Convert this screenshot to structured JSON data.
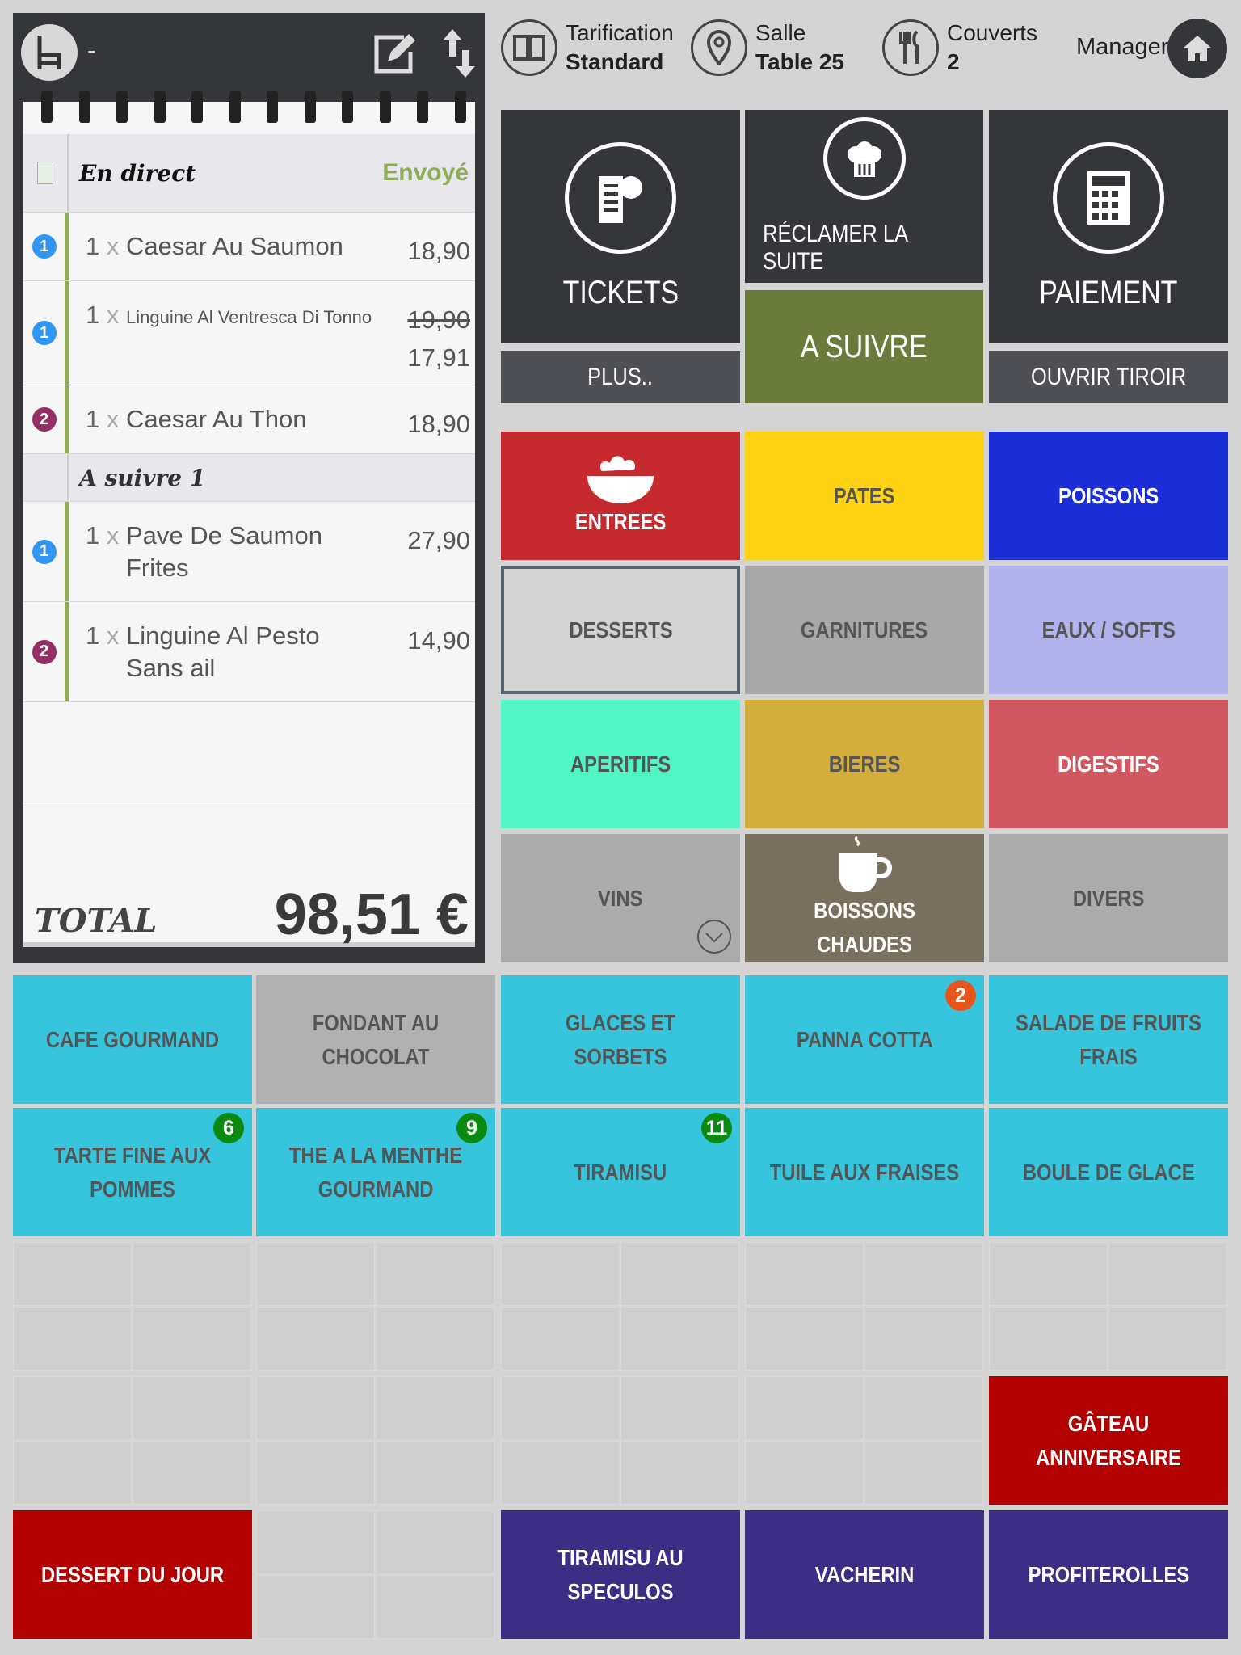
{
  "ticket": {
    "table_dash": "-",
    "header_label": "En direct",
    "header_status": "Envoyé",
    "lines": [
      {
        "seq": "1",
        "seq_color": "#2f96f3",
        "qty": "1",
        "x": "x",
        "name": "Caesar Au Saumon",
        "price": "18,90"
      },
      {
        "seq": "1",
        "seq_color": "#2f96f3",
        "qty": "1",
        "x": "x",
        "name": "Linguine Al Ventresca Di Tonno",
        "old_price": "19,90",
        "price": "17,91"
      },
      {
        "seq": "2",
        "seq_color": "#962e63",
        "qty": "1",
        "x": "x",
        "name": "Caesar Au Thon",
        "price": "18,90"
      }
    ],
    "next_label": "A suivre 1",
    "next_lines": [
      {
        "seq": "1",
        "seq_color": "#2f96f3",
        "qty": "1",
        "x": "x",
        "name": "Pave De Saumon",
        "note": "Frites",
        "price": "27,90"
      },
      {
        "seq": "2",
        "seq_color": "#962e63",
        "qty": "1",
        "x": "x",
        "name": "Linguine Al Pesto",
        "note": "Sans ail",
        "price": "14,90"
      }
    ],
    "total_label": "TOTAL",
    "total_value": "98,51 €"
  },
  "header": {
    "pricing_label": "Tarification",
    "pricing_value": "Standard",
    "room_label": "Salle",
    "room_value": "Table 25",
    "covers_label": "Couverts",
    "covers_value": "2",
    "user": "Manager"
  },
  "controls": {
    "tickets": "TICKETS",
    "more": "PLUS..",
    "claim": "RÉCLAMER LA SUITE",
    "next": "A SUIVRE",
    "payment": "PAIEMENT",
    "drawer": "OUVRIR TIROIR",
    "next_color": "#6a7b3b"
  },
  "categories": [
    {
      "label": "ENTREES",
      "bg": "#c62a2f",
      "fg": "#ffffff",
      "icon": "salad-bowl-icon"
    },
    {
      "label": "PATES",
      "bg": "#ffd314",
      "fg": "#555555"
    },
    {
      "label": "POISSONS",
      "bg": "#1a2dd6",
      "fg": "#ffffff"
    },
    {
      "label": "DESSERTS",
      "bg": "#d3d3d3",
      "fg": "#555555",
      "selected": true
    },
    {
      "label": "GARNITURES",
      "bg": "#a8a8a8",
      "fg": "#555555"
    },
    {
      "label": "EAUX / SOFTS",
      "bg": "#b2b2ec",
      "fg": "#555555"
    },
    {
      "label": "APERITIFS",
      "bg": "#52f5c6",
      "fg": "#555555"
    },
    {
      "label": "BIERES",
      "bg": "#d4ae3c",
      "fg": "#555555"
    },
    {
      "label": "DIGESTIFS",
      "bg": "#d15760",
      "fg": "#ffffff"
    },
    {
      "label": "VINS",
      "bg": "#ababab",
      "fg": "#555555",
      "icon": "chevron-down-icon"
    },
    {
      "label": "BOISSONS CHAUDES",
      "bg": "#7a7060",
      "fg": "#ffffff",
      "icon": "coffee-cup-icon"
    },
    {
      "label": "DIVERS",
      "bg": "#ababab",
      "fg": "#555555"
    }
  ],
  "products": [
    {
      "label": "CAFE GOURMAND",
      "row": 0,
      "col": 0,
      "bg": "#36c5dc",
      "fg": "#555555"
    },
    {
      "label": "FONDANT AU CHOCOLAT",
      "row": 0,
      "col": 1,
      "bg": "#b0b0b0",
      "fg": "#555555"
    },
    {
      "label": "GLACES ET SORBETS",
      "row": 0,
      "col": 2,
      "bg": "#36c5dc",
      "fg": "#555555"
    },
    {
      "label": "PANNA COTTA",
      "row": 0,
      "col": 3,
      "bg": "#36c5dc",
      "fg": "#555555",
      "count": "2",
      "count_color": "#e8541a"
    },
    {
      "label": "SALADE DE FRUITS FRAIS",
      "row": 0,
      "col": 4,
      "bg": "#36c5dc",
      "fg": "#555555"
    },
    {
      "label": "TARTE FINE AUX POMMES",
      "row": 1,
      "col": 0,
      "bg": "#36c5dc",
      "fg": "#555555",
      "count": "6",
      "count_color": "#0a8a10"
    },
    {
      "label": "THE A LA MENTHE GOURMAND",
      "row": 1,
      "col": 1,
      "bg": "#36c5dc",
      "fg": "#555555",
      "count": "9",
      "count_color": "#0a8a10"
    },
    {
      "label": "TIRAMISU",
      "row": 1,
      "col": 2,
      "bg": "#36c5dc",
      "fg": "#555555",
      "count": "11",
      "count_color": "#0a8a10"
    },
    {
      "label": "TUILE AUX FRAISES",
      "row": 1,
      "col": 3,
      "bg": "#36c5dc",
      "fg": "#555555"
    },
    {
      "label": "BOULE DE GLACE",
      "row": 1,
      "col": 4,
      "bg": "#36c5dc",
      "fg": "#555555"
    },
    {
      "label": "GÂTEAU ANNIVERSAIRE",
      "row": 3,
      "col": 4,
      "bg": "#b30000",
      "fg": "#ffffff"
    },
    {
      "label": "DESSERT DU JOUR",
      "row": 4,
      "col": 0,
      "bg": "#b30000",
      "fg": "#ffffff"
    },
    {
      "label": "TIRAMISU AU SPECULOS",
      "row": 4,
      "col": 2,
      "bg": "#3c2d85",
      "fg": "#ffffff"
    },
    {
      "label": "VACHERIN",
      "row": 4,
      "col": 3,
      "bg": "#3c2d85",
      "fg": "#ffffff"
    },
    {
      "label": "PROFITEROLLES",
      "row": 4,
      "col": 4,
      "bg": "#3c2d85",
      "fg": "#ffffff"
    }
  ]
}
